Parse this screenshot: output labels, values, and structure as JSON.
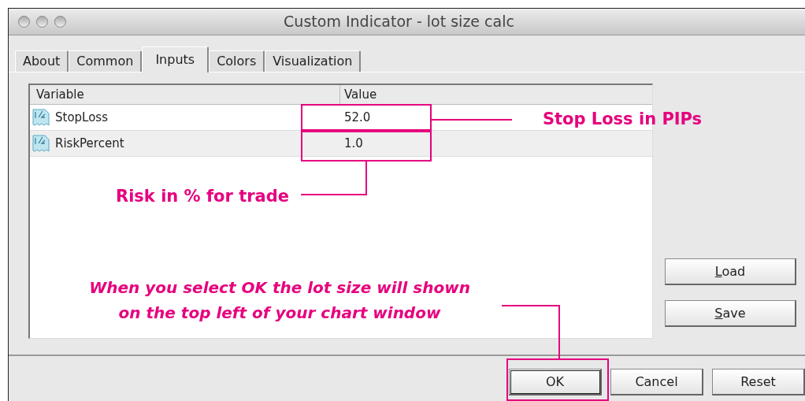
{
  "window": {
    "title": "Custom Indicator - lot size calc"
  },
  "tabs": [
    {
      "label": "About",
      "selected": false
    },
    {
      "label": "Common",
      "selected": false
    },
    {
      "label": "Inputs",
      "selected": true
    },
    {
      "label": "Colors",
      "selected": false
    },
    {
      "label": "Visualization",
      "selected": false
    }
  ],
  "table": {
    "columns": [
      "Variable",
      "Value"
    ],
    "rows": [
      {
        "variable": "StopLoss",
        "value": "52.0",
        "selected": false
      },
      {
        "variable": "RiskPercent",
        "value": "1.0",
        "selected": true
      }
    ]
  },
  "side_buttons": [
    {
      "label": "Load",
      "underline_first": true
    },
    {
      "label": "Save",
      "underline_first": true
    }
  ],
  "buttons": [
    {
      "label": "OK",
      "default": true
    },
    {
      "label": "Cancel",
      "default": false
    },
    {
      "label": "Reset",
      "default": false
    }
  ],
  "annotations": [
    {
      "text": "Stop Loss in PIPs",
      "italic": false
    },
    {
      "text": "Risk in % for trade",
      "italic": false
    },
    {
      "text": "When you select OK the lot size will shown on the top left of your chart window",
      "italic": true
    }
  ]
}
